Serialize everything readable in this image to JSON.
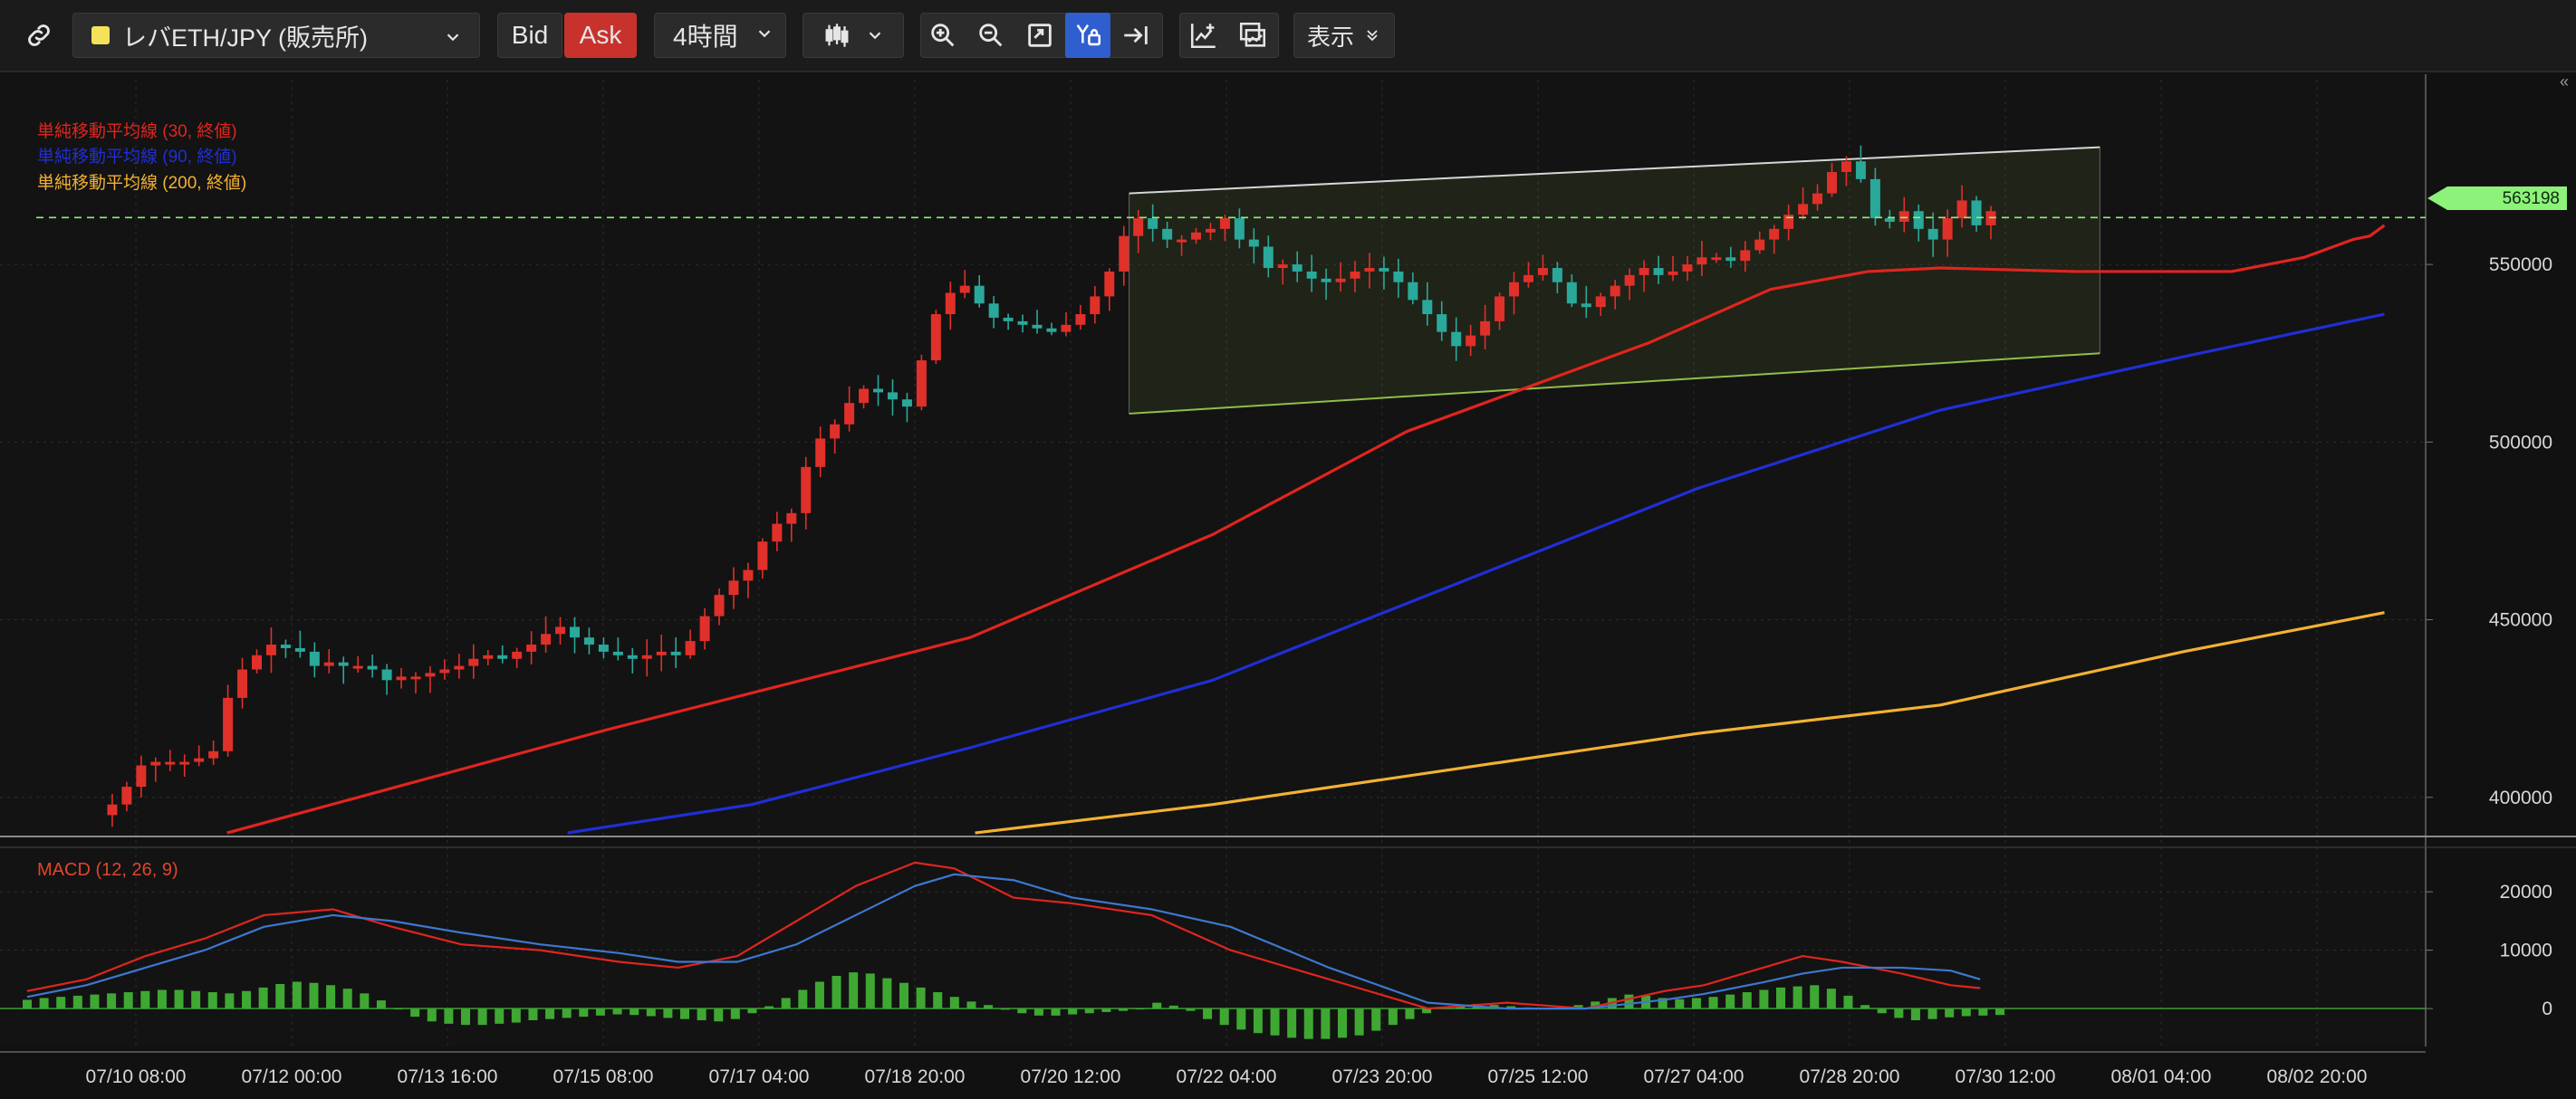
{
  "toolbar": {
    "symbol": "レバETH/JPY (販売所)",
    "symbol_color": "#f4e25a",
    "bid_label": "Bid",
    "ask_label": "Ask",
    "ask_color": "#c8322c",
    "timeframe": "4時間",
    "display_label": "表示",
    "icons": [
      "link-icon",
      "chevron-down-icon",
      "candlestick-icon",
      "zoom-in-icon",
      "zoom-out-icon",
      "fit-screen-icon",
      "lock-y-axis-icon",
      "scroll-to-latest-icon",
      "add-indicator-icon",
      "compare-icon"
    ]
  },
  "legends": [
    {
      "label": "単純移動平均線 (30, 終値)",
      "color": "#e0251e"
    },
    {
      "label": "単純移動平均線 (90, 終値)",
      "color": "#1f2fd6"
    },
    {
      "label": "単純移動平均線 (200, 終値)",
      "color": "#f3b133"
    }
  ],
  "current_price": "563198",
  "chart_data": [
    {
      "type": "candlestick",
      "title": "",
      "x_tick_labels": [
        "07/10 08:00",
        "07/12 00:00",
        "07/13 16:00",
        "07/15 08:00",
        "07/17 04:00",
        "07/18 20:00",
        "07/20 12:00",
        "07/22 04:00",
        "07/23 20:00",
        "07/25 12:00",
        "07/27 04:00",
        "07/28 20:00",
        "07/30 12:00",
        "08/01 04:00",
        "08/02 20:00"
      ],
      "y_tick_labels": [
        "400000",
        "450000",
        "500000",
        "550000"
      ],
      "ylim": [
        389000,
        602000
      ],
      "close_path": [
        395000,
        398000,
        403000,
        409000,
        410000,
        410000,
        410000,
        411000,
        413000,
        428000,
        436000,
        440000,
        443000,
        442000,
        441000,
        437000,
        438000,
        437000,
        437000,
        436000,
        433000,
        434000,
        434000,
        435000,
        436000,
        437000,
        439000,
        440000,
        439000,
        441000,
        443000,
        446000,
        448000,
        445000,
        443000,
        441000,
        440000,
        439000,
        440000,
        441000,
        440000,
        444000,
        451000,
        457000,
        461000,
        464000,
        472000,
        477000,
        480000,
        493000,
        501000,
        505000,
        511000,
        515000,
        514000,
        512000,
        510000,
        523000,
        536000,
        542000,
        544000,
        539000,
        535000,
        534000,
        533000,
        532000,
        531000,
        533000,
        536000,
        541000,
        548000,
        558000,
        563000,
        560000,
        557000,
        557000,
        559000,
        560000,
        563000,
        557000,
        555000,
        549000,
        550000,
        548000,
        546000,
        545000,
        546000,
        548000,
        549000,
        548000,
        545000,
        540000,
        536000,
        531000,
        527000,
        530000,
        534000,
        541000,
        545000,
        547000,
        549000,
        545000,
        539000,
        538000,
        541000,
        544000,
        547000,
        549000,
        547000,
        548000,
        550000,
        552000,
        552000,
        551000,
        554000,
        557000,
        560000,
        564000,
        567000,
        570000,
        576000,
        579000,
        574000,
        563000,
        562000,
        565000,
        560000,
        557000,
        563000,
        568000,
        561000,
        565000
      ],
      "overlays": [
        {
          "name": "単純移動平均線 (30, 終値)",
          "color": "#e0251e",
          "x_frac": [
            0.0936,
            0.25,
            0.4,
            0.5,
            0.58,
            0.68,
            0.73,
            0.77,
            0.8,
            0.856,
            0.92,
            0.95,
            0.97,
            0.977,
            0.983
          ],
          "values": [
            390000,
            419000,
            445000,
            474000,
            503000,
            528000,
            543000,
            548000,
            549000,
            548000,
            548000,
            552000,
            557000,
            558000,
            561000
          ]
        },
        {
          "name": "単純移動平均線 (90, 終値)",
          "color": "#1f2fd6",
          "x_frac": [
            0.234,
            0.31,
            0.4,
            0.5,
            0.6,
            0.7,
            0.8,
            0.9,
            0.983
          ],
          "values": [
            390000,
            398000,
            414000,
            433000,
            460000,
            487000,
            509000,
            524000,
            536000
          ]
        },
        {
          "name": "単純移動平均線 (200, 終値)",
          "color": "#f3b133",
          "x_frac": [
            0.402,
            0.5,
            0.6,
            0.7,
            0.8,
            0.9,
            0.983
          ],
          "values": [
            390000,
            398000,
            408000,
            418000,
            426000,
            441000,
            452000
          ]
        }
      ],
      "channel": {
        "upper": {
          "x_frac": [
            0.4655,
            0.8657
          ],
          "values": [
            570000,
            583000
          ]
        },
        "lower": {
          "x_frac": [
            0.4655,
            0.8657
          ],
          "values": [
            508000,
            525000
          ]
        }
      },
      "current_price_line": 563198
    },
    {
      "type": "macd",
      "title": "MACD (12, 26, 9)",
      "y_tick_labels": [
        "0",
        "10000",
        "20000"
      ],
      "ylim": [
        -6500,
        27000
      ],
      "macd_line": {
        "name": "MACD",
        "color": "#e0251e",
        "x_frac": [
          0,
          0.03,
          0.06,
          0.09,
          0.12,
          0.155,
          0.185,
          0.22,
          0.26,
          0.3,
          0.33,
          0.36,
          0.39,
          0.42,
          0.45,
          0.47,
          0.5,
          0.53,
          0.57,
          0.61,
          0.66,
          0.71,
          0.75,
          0.79,
          0.83,
          0.85,
          0.88,
          0.9,
          0.92,
          0.95,
          0.975,
          0.99
        ],
        "values": [
          3000,
          5000,
          9000,
          12000,
          16000,
          17000,
          14000,
          11000,
          10000,
          8000,
          7000,
          9000,
          15000,
          21000,
          25000,
          24000,
          19000,
          18000,
          16000,
          10000,
          5000,
          0,
          1000,
          0,
          3000,
          4000,
          7000,
          9000,
          8000,
          6000,
          4000,
          3500
        ]
      },
      "signal_line": {
        "name": "Signal",
        "color": "#3d78d0",
        "x_frac": [
          0,
          0.03,
          0.06,
          0.09,
          0.12,
          0.155,
          0.185,
          0.22,
          0.26,
          0.3,
          0.33,
          0.36,
          0.39,
          0.42,
          0.45,
          0.47,
          0.5,
          0.53,
          0.57,
          0.61,
          0.66,
          0.71,
          0.75,
          0.79,
          0.83,
          0.85,
          0.88,
          0.9,
          0.92,
          0.95,
          0.975,
          0.99
        ],
        "values": [
          2000,
          4000,
          7000,
          10000,
          14000,
          16000,
          15000,
          13000,
          11000,
          9500,
          8000,
          8000,
          11000,
          16000,
          21000,
          23000,
          22000,
          19000,
          17000,
          14000,
          7000,
          1000,
          0,
          0,
          1500,
          2500,
          4500,
          6000,
          7000,
          7000,
          6500,
          5000
        ]
      },
      "histogram_color": "#3fa832",
      "histogram": [
        1500,
        1800,
        2000,
        2200,
        2400,
        2600,
        2800,
        3000,
        3200,
        3200,
        3000,
        2800,
        2600,
        3000,
        3600,
        4200,
        4600,
        4400,
        4000,
        3400,
        2600,
        1400,
        0,
        -1400,
        -2200,
        -2600,
        -2800,
        -2800,
        -2600,
        -2400,
        -2000,
        -1800,
        -1600,
        -1400,
        -1200,
        -1000,
        -1100,
        -1300,
        -1600,
        -1800,
        -2000,
        -2200,
        -1800,
        -800,
        400,
        1800,
        3200,
        4600,
        5600,
        6200,
        6000,
        5200,
        4400,
        3600,
        2800,
        2000,
        1200,
        600,
        -200,
        -800,
        -1200,
        -1200,
        -1000,
        -800,
        -600,
        -400,
        0,
        1000,
        500,
        -400,
        -1800,
        -2800,
        -3600,
        -4200,
        -4600,
        -5000,
        -5200,
        -5200,
        -5000,
        -4600,
        -3800,
        -2800,
        -1800,
        -800,
        200,
        600,
        800,
        600,
        400,
        200,
        0,
        200,
        600,
        1200,
        1800,
        2400,
        2200,
        1800,
        1600,
        1800,
        2000,
        2400,
        2800,
        3200,
        3600,
        3800,
        4000,
        3400,
        2200,
        600,
        -800,
        -1600,
        -2000,
        -1800,
        -1500,
        -1300,
        -1200,
        -1100
      ]
    }
  ]
}
